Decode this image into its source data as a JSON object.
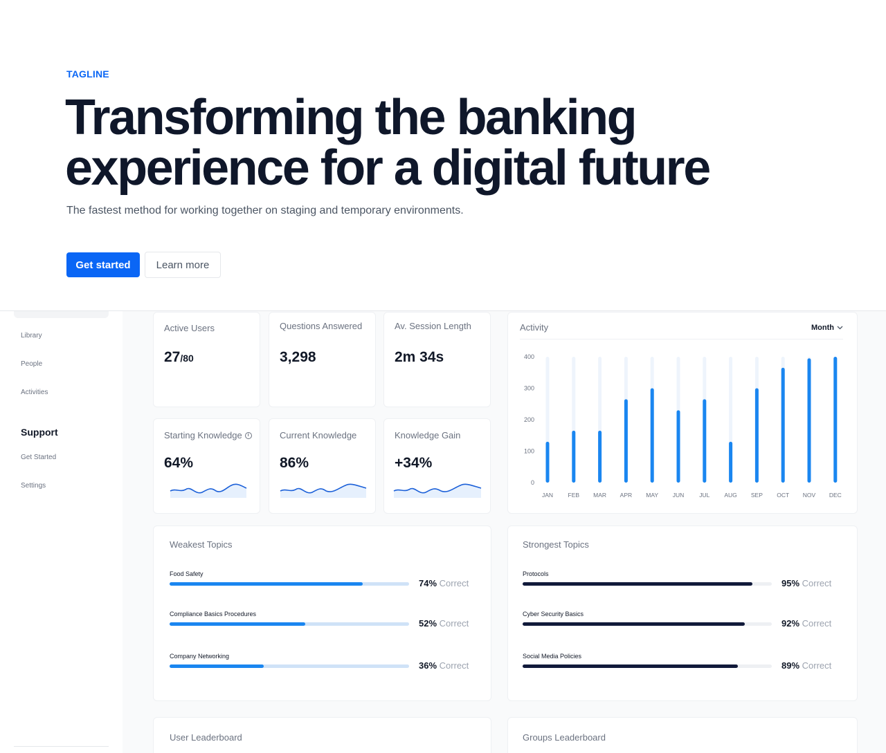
{
  "hero": {
    "tagline": "TAGLINE",
    "headline_line1": "Transforming the banking",
    "headline_line2": "experience for a digital future",
    "subtext": "The fastest method for working together on staging and temporary environments.",
    "primary_button": "Get started",
    "secondary_button": "Learn more",
    "accent_color": "#0a66f5"
  },
  "sidebar": {
    "items": [
      {
        "label": "Library"
      },
      {
        "label": "People"
      },
      {
        "label": "Activities"
      }
    ],
    "support_heading": "Support",
    "support_items": [
      {
        "label": "Get Started"
      },
      {
        "label": "Settings"
      }
    ]
  },
  "stats": [
    {
      "label": "Active Users",
      "value": "27",
      "sub": "/80"
    },
    {
      "label": "Questions Answered",
      "value": "3,298"
    },
    {
      "label": "Av. Session Length",
      "value": "2m 34s"
    },
    {
      "label": "Starting Knowledge",
      "value": "64%",
      "info_icon": "info-icon"
    },
    {
      "label": "Current Knowledge",
      "value": "86%"
    },
    {
      "label": "Knowledge Gain",
      "value": "+34%"
    }
  ],
  "activity": {
    "title": "Activity",
    "period": "Month",
    "period_icon": "chevron-down-icon"
  },
  "chart_data": {
    "type": "bar",
    "title": "Activity",
    "categories": [
      "JAN",
      "FEB",
      "MAR",
      "APR",
      "MAY",
      "JUN",
      "JUL",
      "AUG",
      "SEP",
      "OCT",
      "NOV",
      "DEC"
    ],
    "values": [
      130,
      165,
      165,
      265,
      300,
      230,
      265,
      130,
      300,
      365,
      395,
      400
    ],
    "yticks": [
      0,
      100,
      200,
      300,
      400
    ],
    "ylim": [
      0,
      400
    ],
    "bar_color": "#1a86f0",
    "track_color": "#eef4fc"
  },
  "weakest": {
    "title": "Weakest Topics",
    "items": [
      {
        "name": "Food Safety",
        "pct": "74%",
        "suffix": "Correct",
        "fill": 0.74
      },
      {
        "name": "Compliance Basics Procedures",
        "pct": "52%",
        "suffix": "Correct",
        "fill": 0.52
      },
      {
        "name": "Company Networking",
        "pct": "36%",
        "suffix": "Correct",
        "fill": 0.36
      }
    ],
    "bar_color": "#1a86f0",
    "track_color": "#cfe2f7"
  },
  "strongest": {
    "title": "Strongest Topics",
    "items": [
      {
        "name": "Protocols",
        "pct": "95%",
        "suffix": "Correct",
        "fill": 0.95
      },
      {
        "name": "Cyber Security Basics",
        "pct": "92%",
        "suffix": "Correct",
        "fill": 0.92
      },
      {
        "name": "Social Media Policies",
        "pct": "89%",
        "suffix": "Correct",
        "fill": 0.89
      }
    ],
    "bar_color": "#111a3a",
    "track_color": "#eef0f3"
  },
  "leaderboards": {
    "user_title": "User Leaderboard",
    "groups_title": "Groups Leaderboard"
  }
}
